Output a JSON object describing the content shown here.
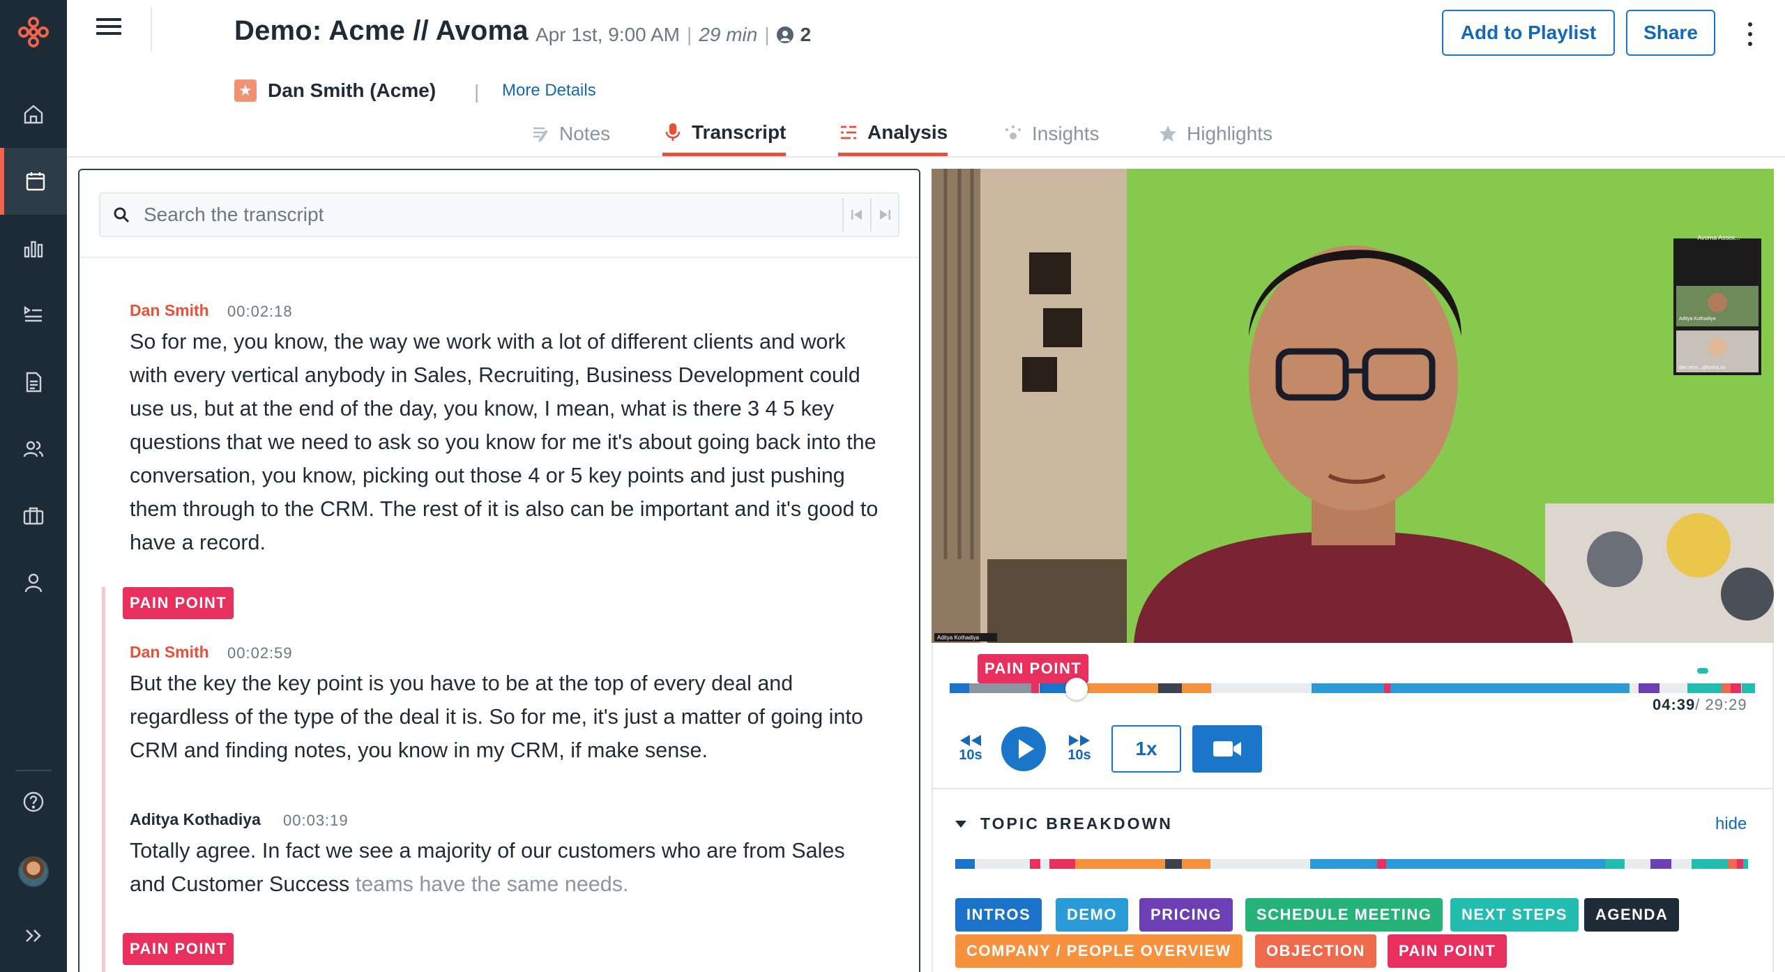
{
  "colors": {
    "rail_bg": "#1d2b36",
    "brand_red": "#e8503a",
    "link_blue": "#1468b8",
    "pain_point": "#e8305f"
  },
  "sidebar": {
    "items": [
      {
        "name": "home",
        "icon": "home-icon",
        "active": false
      },
      {
        "name": "meetings",
        "icon": "calendar-icon",
        "active": true
      },
      {
        "name": "insights",
        "icon": "bar-chart-icon",
        "active": false
      },
      {
        "name": "playlists",
        "icon": "playlist-icon",
        "active": false
      },
      {
        "name": "documents",
        "icon": "document-icon",
        "active": false
      },
      {
        "name": "team",
        "icon": "users-icon",
        "active": false
      },
      {
        "name": "deals",
        "icon": "briefcase-icon",
        "active": false
      },
      {
        "name": "profile",
        "icon": "user-icon",
        "active": false
      },
      {
        "name": "help",
        "icon": "help-icon",
        "active": false
      },
      {
        "name": "expand",
        "icon": "double-chevron-right-icon",
        "active": false
      }
    ]
  },
  "header": {
    "title": "Demo: Acme // Avoma",
    "date": "Apr 1st, 9:00 AM",
    "separator": "|",
    "duration": "29 min",
    "participants": "2",
    "account": "Dan Smith (Acme)",
    "more_details": "More Details",
    "add_to_playlist": "Add to Playlist",
    "share": "Share"
  },
  "tabs": [
    {
      "label": "Notes",
      "icon": "notes-icon",
      "active": false
    },
    {
      "label": "Transcript",
      "icon": "microphone-icon",
      "active": true
    },
    {
      "label": "Analysis",
      "icon": "analysis-icon",
      "active": true
    },
    {
      "label": "Insights",
      "icon": "sparkle-icon",
      "active": false
    },
    {
      "label": "Highlights",
      "icon": "star-icon",
      "active": false
    }
  ],
  "transcript": {
    "search_placeholder": "Search the transcript",
    "utterances": [
      {
        "speaker": "Dan Smith",
        "time": "00:02:18",
        "text": "So for me, you know, the way we work with a lot of different clients and work with every vertical anybody in Sales, Recruiting, Business Development could use us, but at the end of the day, you know, I mean, what is there 3 4 5 key questions that we need to ask so you know for me it's about going back into the conversation, you know, picking out those 4 or 5 key points and just pushing them through to the CRM. The rest of it is also can be important and it's good to have a record."
      },
      {
        "tag": "PAIN POINT",
        "speaker": "Dan Smith",
        "time": "00:02:59",
        "text": "But the key the key point is you have to be at the top of every deal and regardless of the type of the deal it is. So for me, it's just a matter of going into CRM and finding notes, you know in my CRM, if make sense."
      },
      {
        "speaker": "Aditya Kothadiya",
        "time": "00:03:19",
        "text": "Totally agree. In fact we see a majority of our customers who are from Sales and Customer Success",
        "text_pending": "teams have the same needs."
      },
      {
        "tag": "PAIN POINT"
      }
    ]
  },
  "video": {
    "participant_name": "Aditya Kothadiya",
    "thumb_title": "Avoma Assist...",
    "thumb_people": [
      "Aditya Kothadiya",
      "dan.reyn...@lusha.co"
    ]
  },
  "player": {
    "current_tag": "PAIN POINT",
    "current_time": "04:39",
    "total_time": "/ 29:29",
    "progress": 0.158,
    "skip_back": "10s",
    "skip_forward": "10s",
    "speed": "1x"
  },
  "topic_breakdown": {
    "title": "TOPIC BREAKDOWN",
    "hide": "hide",
    "topics": [
      {
        "label": "INTROS",
        "color": "#1a73c8"
      },
      {
        "label": "DEMO",
        "color": "#2a9bd6"
      },
      {
        "label": "PRICING",
        "color": "#6c3fb5"
      },
      {
        "label": "SCHEDULE MEETING",
        "color": "#26b37a"
      },
      {
        "label": "NEXT STEPS",
        "color": "#22bdb0"
      },
      {
        "label": "AGENDA",
        "color": "#1f2b37"
      },
      {
        "label": "COMPANY / PEOPLE OVERVIEW",
        "color": "#f6913d"
      },
      {
        "label": "OBJECTION",
        "color": "#ee6a4c"
      },
      {
        "label": "PAIN POINT",
        "color": "#e8305f"
      }
    ]
  }
}
